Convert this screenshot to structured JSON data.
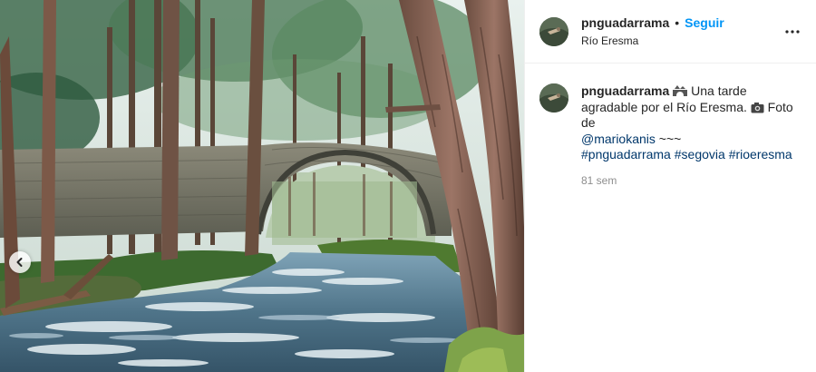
{
  "post": {
    "username": "pnguadarrama",
    "separator": "•",
    "follow_label": "Seguir",
    "location": "Río Eresma",
    "more_icon": "more-horizontal-icon",
    "caption": {
      "username": "pnguadarrama",
      "text_part1": "Una tarde agradable por el Río Eresma.",
      "text_part2": "Foto de",
      "mention": "@mariokanis",
      "tilde": "~~~",
      "hashtags": [
        "#pnguadarrama",
        "#segovia",
        "#rioeresma"
      ],
      "emoji1_icon": "stone-bridge-emoji-icon",
      "emoji2_icon": "camera-emoji-icon"
    },
    "timestamp": "81 sem"
  },
  "media": {
    "alt_icon": "river-bridge-photo",
    "carousel_prev_icon": "chevron-left-icon"
  },
  "colors": {
    "follow": "#0095f6",
    "link": "#00376b",
    "muted": "#8e8e8e",
    "text": "#262626",
    "border": "#efefef"
  }
}
